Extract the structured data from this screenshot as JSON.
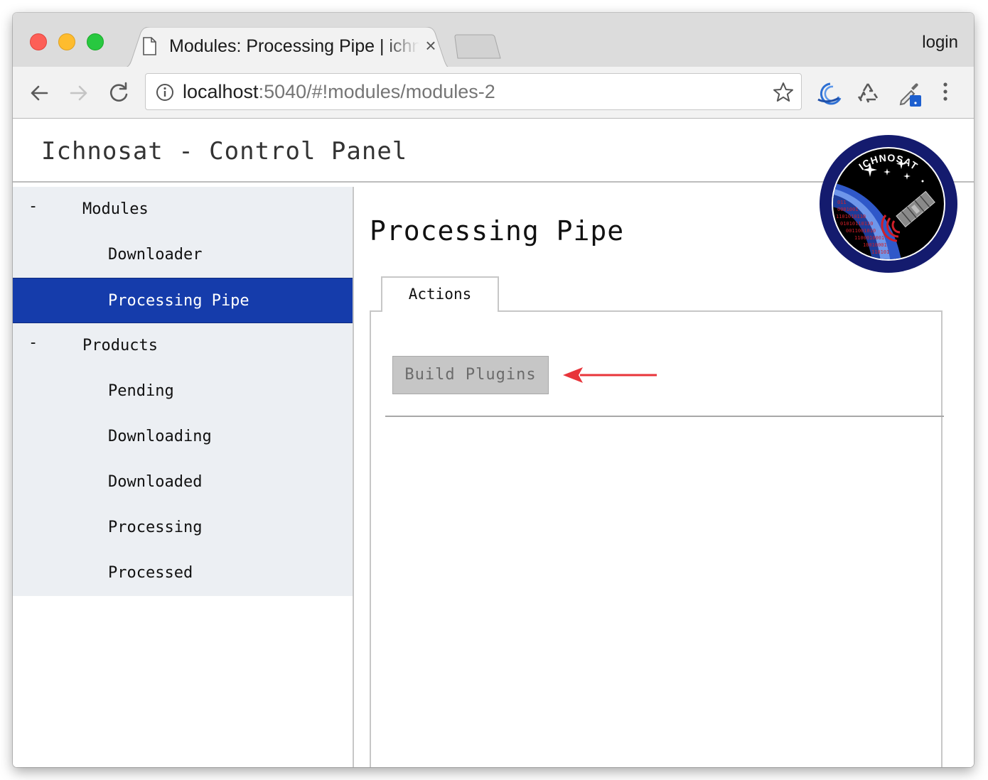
{
  "browser": {
    "tab_title": "Modules: Processing Pipe | ichnosat",
    "close_glyph": "×",
    "profile_label": "login",
    "url_host": "localhost",
    "url_rest": ":5040/#!modules/modules-2"
  },
  "app": {
    "title": "Ichnosat - Control Panel",
    "logo_text": "ICHNOSAT"
  },
  "sidebar": {
    "groups": [
      {
        "collapse_glyph": "-",
        "label": "Modules",
        "items": [
          {
            "label": "Downloader",
            "active": false
          },
          {
            "label": "Processing Pipe",
            "active": true
          }
        ]
      },
      {
        "collapse_glyph": "-",
        "label": "Products",
        "items": [
          {
            "label": "Pending",
            "active": false
          },
          {
            "label": "Downloading",
            "active": false
          },
          {
            "label": "Downloaded",
            "active": false
          },
          {
            "label": "Processing",
            "active": false
          },
          {
            "label": "Processed",
            "active": false
          }
        ]
      }
    ]
  },
  "main": {
    "heading": "Processing Pipe",
    "tabs": [
      {
        "label": "Actions",
        "active": true
      }
    ],
    "actions": {
      "build_button_label": "Build Plugins"
    }
  },
  "colors": {
    "active_nav": "#153cab",
    "sidebar_bg": "#eceff3",
    "arrow": "#e8343a",
    "logo_ring": "#141b6e"
  }
}
